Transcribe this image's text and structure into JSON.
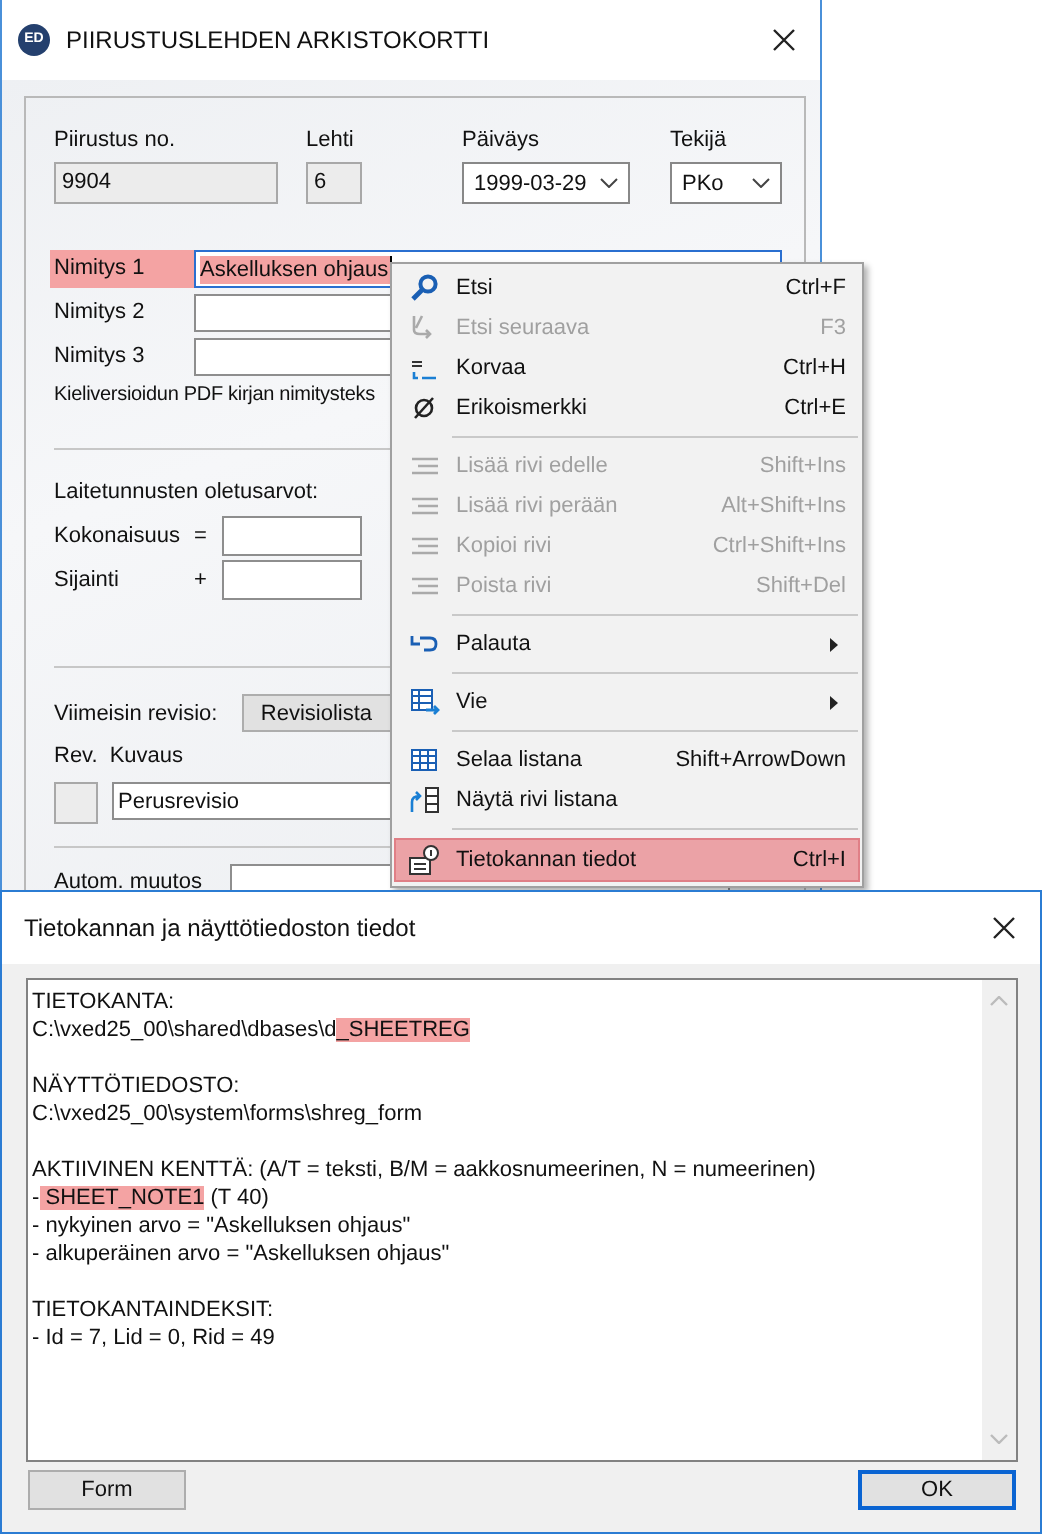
{
  "main_window": {
    "logo": "ED",
    "title": "PIIRUSTUSLEHDEN ARKISTOKORTTI",
    "header_fields": [
      {
        "label": "Piirustus no.",
        "value": "9904",
        "kind": "readonly"
      },
      {
        "label": "Lehti",
        "value": "6",
        "kind": "readonly"
      },
      {
        "label": "Päiväys",
        "value": "1999-03-29",
        "kind": "dropdown"
      },
      {
        "label": "Tekijä",
        "value": "PKo",
        "kind": "dropdown"
      }
    ],
    "name_fields": [
      {
        "label": "Nimitys 1",
        "value": "Askelluksen ohjaus",
        "highlighted": true,
        "focused": true
      },
      {
        "label": "Nimitys 2",
        "highlighted": false,
        "focused": false
      },
      {
        "label": "Nimitys 3",
        "highlighted": false,
        "focused": false
      }
    ],
    "pdf_note": "Kieliversioidun PDF kirjan nimitysteks",
    "defaults": {
      "heading": "Laitetunnusten oletusarvot:",
      "fields": [
        {
          "label": "Kokonaisuus",
          "symbol": "="
        },
        {
          "label": "Sijainti",
          "symbol": "+"
        }
      ]
    },
    "revision": {
      "label": "Viimeisin revisio:",
      "button": "Revisiolista",
      "rev_label": "Rev.",
      "description_label": "Kuvaus",
      "description": "Perusrevisio"
    },
    "autom_label": "Autom. muutos"
  },
  "context_menu": {
    "items": [
      {
        "kind": "item",
        "label": "Etsi",
        "shortcut": "Ctrl+F",
        "disabled": false,
        "submenu": false,
        "selected": false
      },
      {
        "kind": "item",
        "label": "Etsi seuraava",
        "shortcut": "F3",
        "disabled": true,
        "submenu": false,
        "selected": false
      },
      {
        "kind": "item",
        "label": "Korvaa",
        "shortcut": "Ctrl+H",
        "disabled": false,
        "submenu": false,
        "selected": false
      },
      {
        "kind": "item",
        "label": "Erikoismerkki",
        "shortcut": "Ctrl+E",
        "disabled": false,
        "submenu": false,
        "selected": false
      },
      {
        "kind": "separator"
      },
      {
        "kind": "item",
        "label": "Lisää rivi edelle",
        "shortcut": "Shift+Ins",
        "disabled": true,
        "submenu": false,
        "selected": false
      },
      {
        "kind": "item",
        "label": "Lisää rivi perään",
        "shortcut": "Alt+Shift+Ins",
        "disabled": true,
        "submenu": false,
        "selected": false
      },
      {
        "kind": "item",
        "label": "Kopioi rivi",
        "shortcut": "Ctrl+Shift+Ins",
        "disabled": true,
        "submenu": false,
        "selected": false
      },
      {
        "kind": "item",
        "label": "Poista rivi",
        "shortcut": "Shift+Del",
        "disabled": true,
        "submenu": false,
        "selected": false
      },
      {
        "kind": "separator"
      },
      {
        "kind": "item",
        "label": "Palauta",
        "disabled": false,
        "submenu": true,
        "selected": false
      },
      {
        "kind": "separator"
      },
      {
        "kind": "item",
        "label": "Vie",
        "disabled": false,
        "submenu": true,
        "selected": false
      },
      {
        "kind": "separator"
      },
      {
        "kind": "item",
        "label": "Selaa listana",
        "shortcut": "Shift+ArrowDown",
        "disabled": false,
        "submenu": false,
        "selected": false
      },
      {
        "kind": "item",
        "label": "Näytä rivi listana",
        "disabled": false,
        "submenu": false,
        "selected": false
      },
      {
        "kind": "separator"
      },
      {
        "kind": "item",
        "label": "Tietokannan tiedot",
        "shortcut": "Ctrl+I",
        "disabled": false,
        "submenu": false,
        "selected": true
      }
    ]
  },
  "info_dialog": {
    "title": "Tietokannan ja näyttötiedoston tiedot",
    "sections": [
      {
        "lines": [
          {
            "segments": [
              {
                "text": "TIETOKANTA:",
                "highlighted": false
              }
            ]
          },
          {
            "segments": [
              {
                "text": "C:\\vxed25_00\\shared\\dbases\\d",
                "highlighted": false
              },
              {
                "text": "_SHEETREG",
                "highlighted": true
              }
            ]
          }
        ]
      },
      {
        "lines": [
          {
            "segments": [
              {
                "text": "NÄYTTÖTIEDOSTO:",
                "highlighted": false
              }
            ]
          },
          {
            "segments": [
              {
                "text": "C:\\vxed25_00\\system\\forms\\shreg_form",
                "highlighted": false
              }
            ]
          }
        ]
      },
      {
        "lines": [
          {
            "segments": [
              {
                "text": "AKTIIVINEN KENTTÄ: (A/T = teksti, B/M = aakkosnumeerinen, N = numeerinen)",
                "highlighted": false
              }
            ]
          },
          {
            "segments": [
              {
                "text": "-",
                "highlighted": false
              },
              {
                "text": " SHEET_NOTE1",
                "highlighted": true
              },
              {
                "text": " (T 40)",
                "highlighted": false
              }
            ]
          },
          {
            "segments": [
              {
                "text": "- nykyinen arvo = \"Askelluksen ohjaus\"",
                "highlighted": false
              }
            ]
          },
          {
            "segments": [
              {
                "text": "- alkuperäinen arvo = \"Askelluksen ohjaus\"",
                "highlighted": false
              }
            ]
          }
        ]
      },
      {
        "lines": [
          {
            "segments": [
              {
                "text": "TIETOKANTAINDEKSIT:",
                "highlighted": false
              }
            ]
          },
          {
            "segments": [
              {
                "text": "- Id = 7, Lid = 0, Rid = 49",
                "highlighted": false
              }
            ]
          }
        ]
      }
    ],
    "buttons": [
      {
        "label": "Form",
        "default": false
      },
      {
        "label": "OK",
        "default": true
      }
    ]
  }
}
